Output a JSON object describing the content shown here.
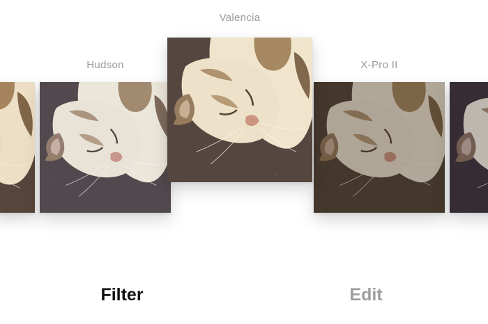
{
  "filters": [
    {
      "id": "partial-left",
      "label": ""
    },
    {
      "id": "hudson",
      "label": "Hudson"
    },
    {
      "id": "valencia",
      "label": "Valencia",
      "selected": true
    },
    {
      "id": "xpro",
      "label": "X-Pro II"
    },
    {
      "id": "partial-right",
      "label": ""
    }
  ],
  "tabs": {
    "filter_label": "Filter",
    "edit_label": "Edit",
    "active": "filter"
  },
  "colors": {
    "active_tab": "#111111",
    "inactive_tab": "#9e9e9e",
    "filter_label": "#9a9a9a",
    "background": "#ffffff"
  }
}
